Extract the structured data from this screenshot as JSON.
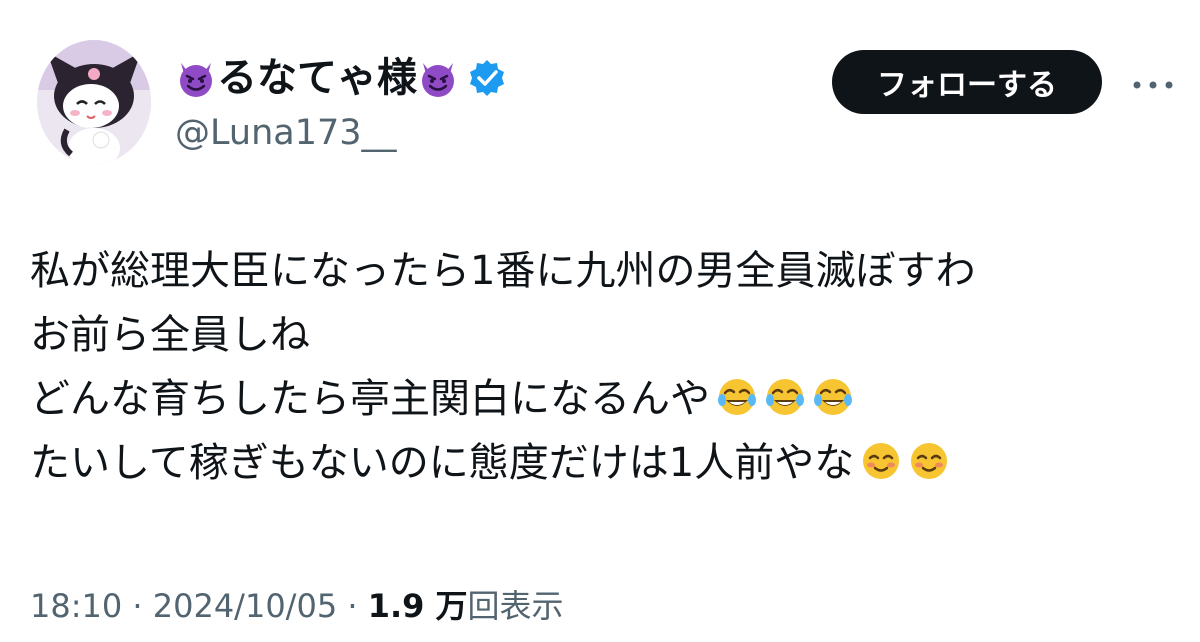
{
  "user": {
    "display_name_text": "るなてゃ様",
    "name_emoji": "smiling-devil-emoji",
    "handle": "@Luna173__",
    "verified_icon": "verified-badge-icon",
    "avatar_icon": "kuromi-avatar"
  },
  "actions": {
    "follow_label": "フォローする",
    "more_icon": "more-dots-icon"
  },
  "tweet": {
    "lines": [
      "私が総理大臣になったら1番に九州の男全員滅ぼすわ",
      "お前ら全員しね",
      "どんな育ちしたら亭主関白になるんや",
      "たいして稼ぎもないのに態度だけは1人前やな"
    ],
    "line3_emoji": "face-with-tears-of-joy-emoji",
    "line4_emoji": "smiling-face-emoji"
  },
  "meta": {
    "time": "18:10",
    "separator": " · ",
    "date": "2024/10/05",
    "views_count": "1.9 万",
    "views_label": "回表示"
  },
  "colors": {
    "text": "#0f1419",
    "secondary": "#536471",
    "button_bg": "#0f1419",
    "verified": "#1d9bf0",
    "devil": "#8f4ac6"
  }
}
